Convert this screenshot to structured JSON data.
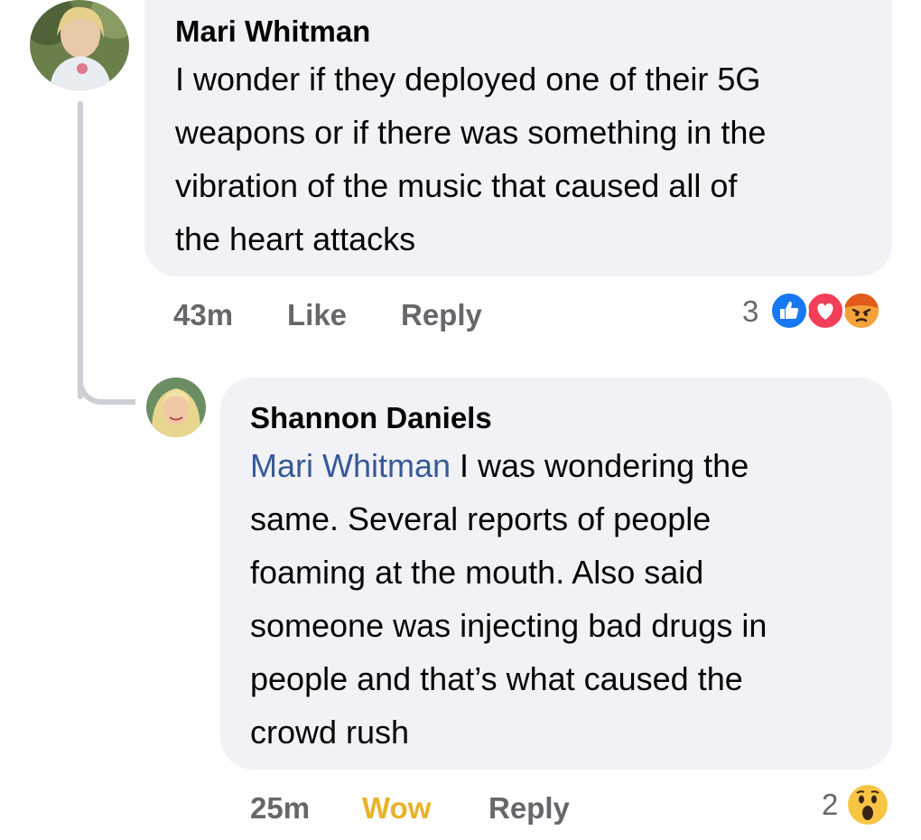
{
  "comments": [
    {
      "author": "Mari Whitman",
      "lines": [
        "I wonder if they deployed one of their 5G",
        "weapons or if there was something in the",
        "vibration of the music that caused all of",
        "the heart attacks"
      ],
      "time": "43m",
      "like_label": "Like",
      "reply_label": "Reply",
      "reaction_count": "3",
      "reactions": [
        "like-icon",
        "love-icon",
        "angry-icon"
      ]
    },
    {
      "author": "Shannon Daniels",
      "mention": "Mari Whitman",
      "lines": [
        " I was wondering the",
        "same. Several reports of people",
        "foaming at the mouth. Also said",
        "someone was injecting bad drugs in",
        "people and that’s what caused the",
        "crowd rush"
      ],
      "time": "25m",
      "like_label": "Wow",
      "reply_label": "Reply",
      "reaction_count": "2",
      "reactions": [
        "wow-icon"
      ]
    }
  ],
  "colors": {
    "bubble": "#f0f2f5",
    "mention": "#385898",
    "action": "#65676b",
    "wow": "#e9b327",
    "like_blue": "#1877f2",
    "love_red": "#f33e58",
    "angry_orange": "#e9710f"
  }
}
